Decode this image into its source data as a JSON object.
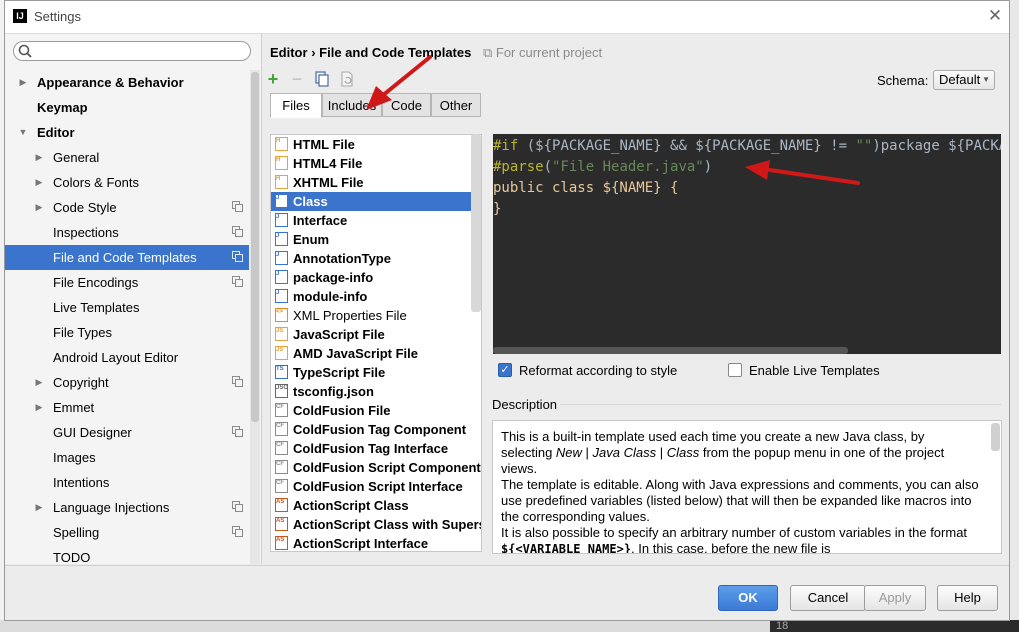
{
  "window": {
    "title": "Settings",
    "app_icon": "IJ"
  },
  "sidebar": {
    "search": {
      "value": "",
      "placeholder": ""
    },
    "items": [
      {
        "label": "Appearance & Behavior",
        "level": 0,
        "bold": true,
        "arrow": "right"
      },
      {
        "label": "Keymap",
        "level": 0,
        "bold": true
      },
      {
        "label": "Editor",
        "level": 0,
        "bold": true,
        "arrow": "down"
      },
      {
        "label": "General",
        "level": 1,
        "arrow": "right"
      },
      {
        "label": "Colors & Fonts",
        "level": 1,
        "arrow": "right"
      },
      {
        "label": "Code Style",
        "level": 1,
        "arrow": "right",
        "copy": true
      },
      {
        "label": "Inspections",
        "level": 1,
        "copy": true
      },
      {
        "label": "File and Code Templates",
        "level": 1,
        "selected": true,
        "copy": true
      },
      {
        "label": "File Encodings",
        "level": 1,
        "copy": true
      },
      {
        "label": "Live Templates",
        "level": 1
      },
      {
        "label": "File Types",
        "level": 1
      },
      {
        "label": "Android Layout Editor",
        "level": 1
      },
      {
        "label": "Copyright",
        "level": 1,
        "arrow": "right",
        "copy": true
      },
      {
        "label": "Emmet",
        "level": 1,
        "arrow": "right"
      },
      {
        "label": "GUI Designer",
        "level": 1,
        "copy": true
      },
      {
        "label": "Images",
        "level": 1
      },
      {
        "label": "Intentions",
        "level": 1
      },
      {
        "label": "Language Injections",
        "level": 1,
        "arrow": "right",
        "copy": true
      },
      {
        "label": "Spelling",
        "level": 1,
        "copy": true
      },
      {
        "label": "TODO",
        "level": 1
      }
    ]
  },
  "breadcrumb": {
    "part1": "Editor",
    "separator": "›",
    "part2": "File and Code Templates",
    "project_note": "For current project"
  },
  "toolbar": {
    "add_icon": "+",
    "remove_icon": "−"
  },
  "schema": {
    "label": "Schema:",
    "value": "Default"
  },
  "tabs": [
    {
      "label": "Files",
      "active": true
    },
    {
      "label": "Includes"
    },
    {
      "label": "Code"
    },
    {
      "label": "Other"
    }
  ],
  "templates": [
    {
      "label": "HTML File",
      "icon": "html"
    },
    {
      "label": "HTML4 File",
      "icon": "html"
    },
    {
      "label": "XHTML File",
      "icon": "html"
    },
    {
      "label": "Class",
      "icon": "java",
      "selected": true
    },
    {
      "label": "Interface",
      "icon": "java"
    },
    {
      "label": "Enum",
      "icon": "java"
    },
    {
      "label": "AnnotationType",
      "icon": "java"
    },
    {
      "label": "package-info",
      "icon": "java"
    },
    {
      "label": "module-info",
      "icon": "java"
    },
    {
      "label": "XML Properties File",
      "icon": "xml",
      "plain": true
    },
    {
      "label": "JavaScript File",
      "icon": "js"
    },
    {
      "label": "AMD JavaScript File",
      "icon": "js"
    },
    {
      "label": "TypeScript File",
      "icon": "ts"
    },
    {
      "label": "tsconfig.json",
      "icon": "json"
    },
    {
      "label": "ColdFusion File",
      "icon": "cf"
    },
    {
      "label": "ColdFusion Tag Component",
      "icon": "cf"
    },
    {
      "label": "ColdFusion Tag Interface",
      "icon": "cf"
    },
    {
      "label": "ColdFusion Script Component",
      "icon": "cf"
    },
    {
      "label": "ColdFusion Script Interface",
      "icon": "cf"
    },
    {
      "label": "ActionScript Class",
      "icon": "as"
    },
    {
      "label": "ActionScript Class with Supers",
      "icon": "as"
    },
    {
      "label": "ActionScript Interface",
      "icon": "as"
    }
  ],
  "icon_badges": {
    "html": "H",
    "java": "J",
    "xml": "<>",
    "js": "JS",
    "ts": "TS",
    "json": "JSON",
    "cf": "CF",
    "as": "AS"
  },
  "editor": {
    "line1": {
      "a": "#if",
      "b": " (${PACKAGE_NAME} && ${PACKAGE_NAME} != ",
      "c": "\"\"",
      "d": ")package ${PACKAGE_NAME};#end"
    },
    "line2": {
      "a": "#parse",
      "b": "(",
      "c": "\"File Header.java\"",
      "d": ")"
    },
    "line3": "public class ${NAME} {",
    "line4": "}"
  },
  "options": {
    "reformat": {
      "label": "Reformat according to style",
      "checked": true
    },
    "live_templates": {
      "label": "Enable Live Templates",
      "checked": false
    }
  },
  "description": {
    "label": "Description",
    "p1_a": "This is a built-in template used each time you create a new Java class, by selecting ",
    "p1_new": "New",
    "p1_sep1": " | ",
    "p1_jc": "Java Class",
    "p1_sep2": " | ",
    "p1_class": "Class",
    "p1_b": " from the popup menu in one of the project views.",
    "p2": "The template is editable. Along with Java expressions and comments, you can also use predefined variables (listed below) that will then be expanded like macros into the corresponding values.",
    "p3_a": "It is also possible to specify an arbitrary number of custom variables in the format ",
    "p3_code": "${<VARIABLE_NAME>}",
    "p3_b": ". In this case, before the new file is"
  },
  "buttons": {
    "ok": "OK",
    "cancel": "Cancel",
    "apply": "Apply",
    "help": "Help"
  },
  "backdrop": {
    "line_number": "18"
  },
  "colors": {
    "selection": "#3b74cc",
    "editor_bg": "#2b2b2b",
    "annotation_arrow": "#e02020",
    "add_icon": "#3fa535"
  }
}
